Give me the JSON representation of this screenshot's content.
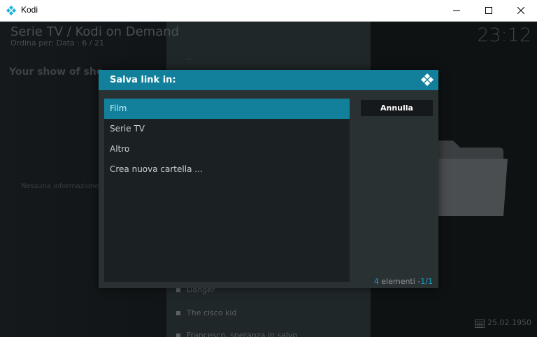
{
  "window": {
    "title": "Kodi",
    "icon": "kodi-logo-icon",
    "controls": [
      "minimize-icon",
      "maximize-icon",
      "close-icon"
    ]
  },
  "background": {
    "breadcrumb": "Serie TV / Kodi on Demand",
    "sort_label": "Ordina per: Data",
    "sort_separator": "·",
    "position": "6 / 21",
    "clock": "23:12",
    "show_title": "Your show of sho",
    "no_info": "Nessuna informazione",
    "parent_item": "..",
    "items": [
      "Danger",
      "The cisco kid",
      "Francesco, speranza in salvo"
    ],
    "date": "25.02.1950"
  },
  "dialog": {
    "title": "Salva link in:",
    "items": [
      "Film",
      "Serie TV",
      "Altro",
      "Crea nuova cartella ..."
    ],
    "focused_index": 0,
    "cancel_label": "Annulla",
    "count_number": "4",
    "count_label": "elementi",
    "count_separator": "-",
    "page": "1/1"
  },
  "colors": {
    "accent": "#12809a",
    "dialog_bg": "#2a3133",
    "list_bg": "#1b2123"
  }
}
